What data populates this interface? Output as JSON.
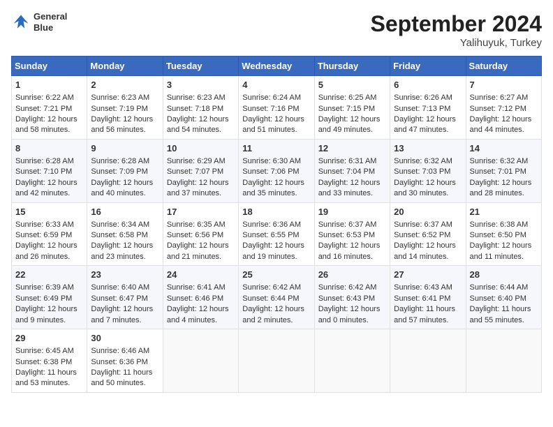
{
  "header": {
    "logo_line1": "General",
    "logo_line2": "Blue",
    "title": "September 2024",
    "subtitle": "Yalihuyuk, Turkey"
  },
  "weekdays": [
    "Sunday",
    "Monday",
    "Tuesday",
    "Wednesday",
    "Thursday",
    "Friday",
    "Saturday"
  ],
  "weeks": [
    [
      {
        "day": "1",
        "sunrise": "6:22 AM",
        "sunset": "7:21 PM",
        "daylight": "12 hours and 58 minutes."
      },
      {
        "day": "2",
        "sunrise": "6:23 AM",
        "sunset": "7:19 PM",
        "daylight": "12 hours and 56 minutes."
      },
      {
        "day": "3",
        "sunrise": "6:23 AM",
        "sunset": "7:18 PM",
        "daylight": "12 hours and 54 minutes."
      },
      {
        "day": "4",
        "sunrise": "6:24 AM",
        "sunset": "7:16 PM",
        "daylight": "12 hours and 51 minutes."
      },
      {
        "day": "5",
        "sunrise": "6:25 AM",
        "sunset": "7:15 PM",
        "daylight": "12 hours and 49 minutes."
      },
      {
        "day": "6",
        "sunrise": "6:26 AM",
        "sunset": "7:13 PM",
        "daylight": "12 hours and 47 minutes."
      },
      {
        "day": "7",
        "sunrise": "6:27 AM",
        "sunset": "7:12 PM",
        "daylight": "12 hours and 44 minutes."
      }
    ],
    [
      {
        "day": "8",
        "sunrise": "6:28 AM",
        "sunset": "7:10 PM",
        "daylight": "12 hours and 42 minutes."
      },
      {
        "day": "9",
        "sunrise": "6:28 AM",
        "sunset": "7:09 PM",
        "daylight": "12 hours and 40 minutes."
      },
      {
        "day": "10",
        "sunrise": "6:29 AM",
        "sunset": "7:07 PM",
        "daylight": "12 hours and 37 minutes."
      },
      {
        "day": "11",
        "sunrise": "6:30 AM",
        "sunset": "7:06 PM",
        "daylight": "12 hours and 35 minutes."
      },
      {
        "day": "12",
        "sunrise": "6:31 AM",
        "sunset": "7:04 PM",
        "daylight": "12 hours and 33 minutes."
      },
      {
        "day": "13",
        "sunrise": "6:32 AM",
        "sunset": "7:03 PM",
        "daylight": "12 hours and 30 minutes."
      },
      {
        "day": "14",
        "sunrise": "6:32 AM",
        "sunset": "7:01 PM",
        "daylight": "12 hours and 28 minutes."
      }
    ],
    [
      {
        "day": "15",
        "sunrise": "6:33 AM",
        "sunset": "6:59 PM",
        "daylight": "12 hours and 26 minutes."
      },
      {
        "day": "16",
        "sunrise": "6:34 AM",
        "sunset": "6:58 PM",
        "daylight": "12 hours and 23 minutes."
      },
      {
        "day": "17",
        "sunrise": "6:35 AM",
        "sunset": "6:56 PM",
        "daylight": "12 hours and 21 minutes."
      },
      {
        "day": "18",
        "sunrise": "6:36 AM",
        "sunset": "6:55 PM",
        "daylight": "12 hours and 19 minutes."
      },
      {
        "day": "19",
        "sunrise": "6:37 AM",
        "sunset": "6:53 PM",
        "daylight": "12 hours and 16 minutes."
      },
      {
        "day": "20",
        "sunrise": "6:37 AM",
        "sunset": "6:52 PM",
        "daylight": "12 hours and 14 minutes."
      },
      {
        "day": "21",
        "sunrise": "6:38 AM",
        "sunset": "6:50 PM",
        "daylight": "12 hours and 11 minutes."
      }
    ],
    [
      {
        "day": "22",
        "sunrise": "6:39 AM",
        "sunset": "6:49 PM",
        "daylight": "12 hours and 9 minutes."
      },
      {
        "day": "23",
        "sunrise": "6:40 AM",
        "sunset": "6:47 PM",
        "daylight": "12 hours and 7 minutes."
      },
      {
        "day": "24",
        "sunrise": "6:41 AM",
        "sunset": "6:46 PM",
        "daylight": "12 hours and 4 minutes."
      },
      {
        "day": "25",
        "sunrise": "6:42 AM",
        "sunset": "6:44 PM",
        "daylight": "12 hours and 2 minutes."
      },
      {
        "day": "26",
        "sunrise": "6:42 AM",
        "sunset": "6:43 PM",
        "daylight": "12 hours and 0 minutes."
      },
      {
        "day": "27",
        "sunrise": "6:43 AM",
        "sunset": "6:41 PM",
        "daylight": "11 hours and 57 minutes."
      },
      {
        "day": "28",
        "sunrise": "6:44 AM",
        "sunset": "6:40 PM",
        "daylight": "11 hours and 55 minutes."
      }
    ],
    [
      {
        "day": "29",
        "sunrise": "6:45 AM",
        "sunset": "6:38 PM",
        "daylight": "11 hours and 53 minutes."
      },
      {
        "day": "30",
        "sunrise": "6:46 AM",
        "sunset": "6:36 PM",
        "daylight": "11 hours and 50 minutes."
      },
      null,
      null,
      null,
      null,
      null
    ]
  ],
  "labels": {
    "sunrise": "Sunrise:",
    "sunset": "Sunset:",
    "daylight": "Daylight:"
  }
}
